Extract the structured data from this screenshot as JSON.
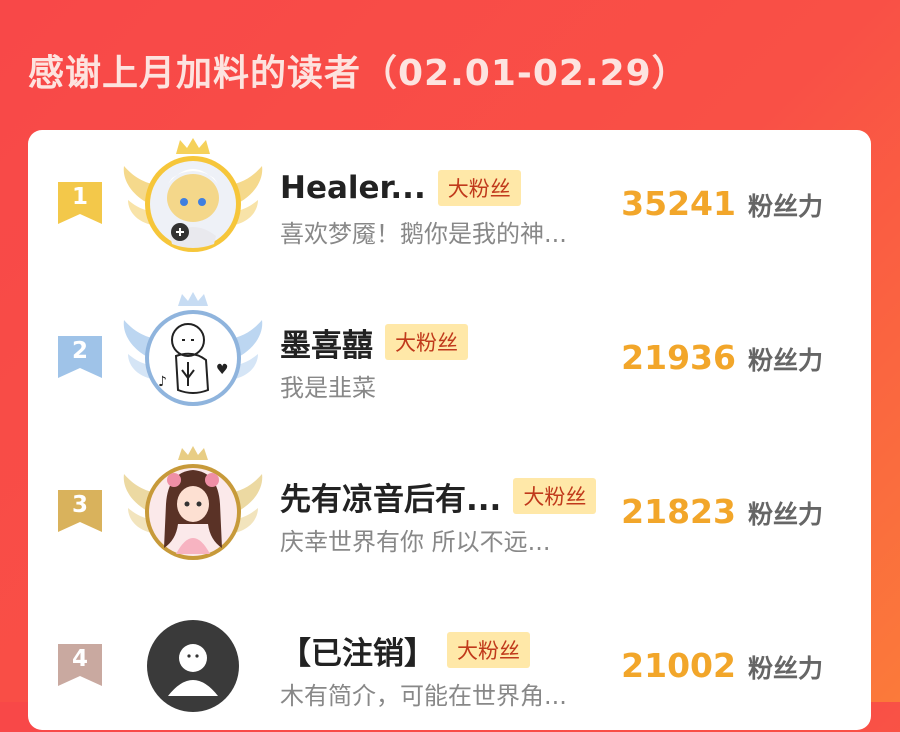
{
  "header": {
    "title": "感谢上月加料的读者（02.01-02.29）"
  },
  "colors": {
    "gold": "#f3c84a",
    "silver": "#9fc3e8",
    "bronze": "#d9b25c",
    "grey": "#c9a9a0",
    "score": "#f2a62a"
  },
  "fans": [
    {
      "rank": "1",
      "name": "Healer...",
      "badge": "大粉丝",
      "bio": "喜欢梦魇！鹅你是我的神...",
      "score": "35241",
      "unit": "粉丝力"
    },
    {
      "rank": "2",
      "name": "墨喜囍",
      "badge": "大粉丝",
      "bio": "我是韭菜",
      "score": "21936",
      "unit": "粉丝力"
    },
    {
      "rank": "3",
      "name": "先有凉音后有...",
      "badge": "大粉丝",
      "bio": "庆幸世界有你 所以不远...",
      "score": "21823",
      "unit": "粉丝力"
    },
    {
      "rank": "4",
      "name": "【已注销】",
      "badge": "大粉丝",
      "bio": "木有简介，可能在世界角...",
      "score": "21002",
      "unit": "粉丝力"
    }
  ]
}
